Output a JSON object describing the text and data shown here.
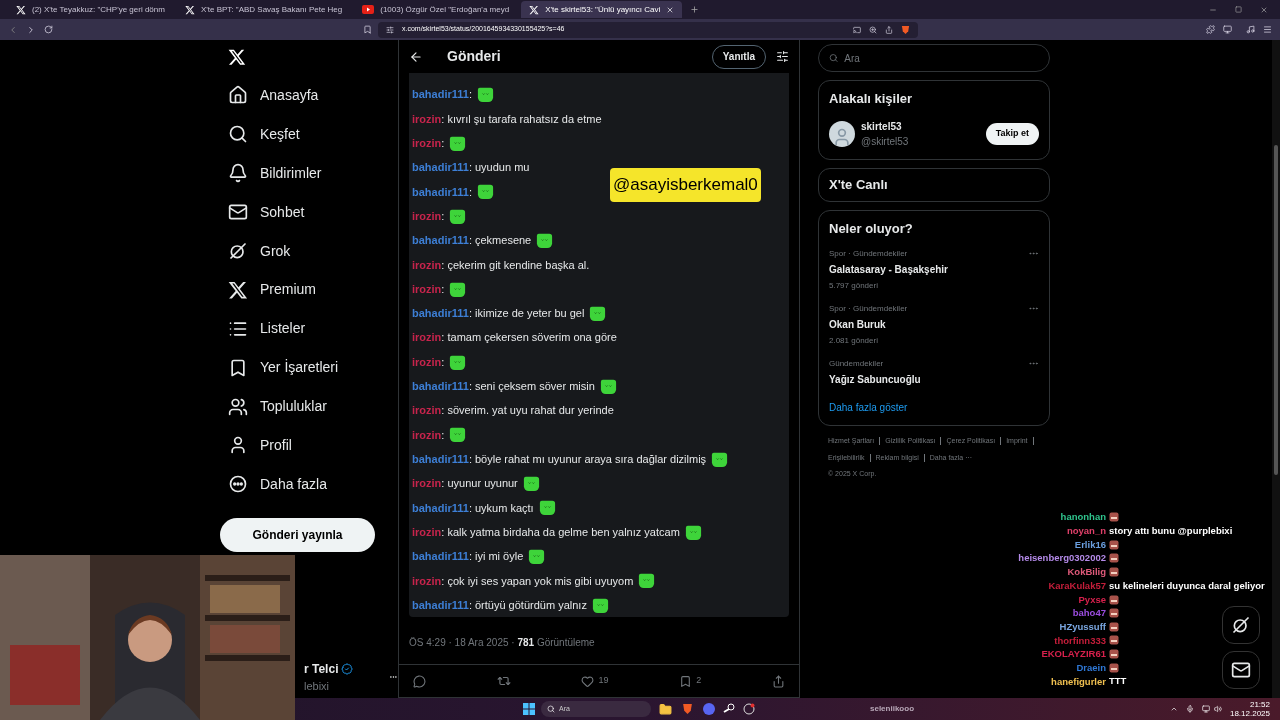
{
  "browser": {
    "tabs": [
      {
        "title": "(2) X'te Teyakkuz: \"CHP'ye geri dönm",
        "kind": "x",
        "selected": false
      },
      {
        "title": "X'te BPT: \"ABD Savaş Bakanı Pete Heg",
        "kind": "x",
        "selected": false
      },
      {
        "title": "(1003) Özgür Özel \"Erdoğan'a meyd",
        "kind": "video",
        "selected": false
      },
      {
        "title": "X'te skirtel53: \"Ünlü yayıncı Cavi",
        "kind": "x",
        "selected": true
      }
    ],
    "url": "x.com/skirtel53/status/2001645934330155425?s=46"
  },
  "nav": [
    {
      "label": "Anasayfa"
    },
    {
      "label": "Keşfet"
    },
    {
      "label": "Bildirimler"
    },
    {
      "label": "Sohbet"
    },
    {
      "label": "Grok"
    },
    {
      "label": "Premium"
    },
    {
      "label": "Listeler"
    },
    {
      "label": "Yer İşaretleri"
    },
    {
      "label": "Topluluklar"
    },
    {
      "label": "Profil"
    },
    {
      "label": "Daha fazla"
    }
  ],
  "post_button": "Gönderi yayınla",
  "account": {
    "name": "r Telci",
    "handle": "lebixi"
  },
  "post": {
    "title": "Gönderi",
    "reply_button": "Yanıtla",
    "tag": "@asayisberkemal0",
    "messages": [
      {
        "user": "bahadir111",
        "color": "#3d7fd6",
        "text": ":",
        "emote": true
      },
      {
        "user": "irozin",
        "color": "#c7244c",
        "text": ": kıvrıl şu tarafa rahatsız da etme",
        "emote": false
      },
      {
        "user": "irozin",
        "color": "#c7244c",
        "text": ":",
        "emote": true
      },
      {
        "user": "bahadir111",
        "color": "#3d7fd6",
        "text": ": uyudun mu",
        "emote": false
      },
      {
        "user": "bahadir111",
        "color": "#3d7fd6",
        "text": ":",
        "emote": true
      },
      {
        "user": "irozin",
        "color": "#c7244c",
        "text": ":",
        "emote": true
      },
      {
        "user": "bahadir111",
        "color": "#3d7fd6",
        "text": ": çekmesene",
        "emote": true
      },
      {
        "user": "irozin",
        "color": "#c7244c",
        "text": ": çekerim git kendine başka al.",
        "emote": false
      },
      {
        "user": "irozin",
        "color": "#c7244c",
        "text": ":",
        "emote": true
      },
      {
        "user": "bahadir111",
        "color": "#3d7fd6",
        "text": ": ikimize de yeter bu gel",
        "emote": true
      },
      {
        "user": "irozin",
        "color": "#c7244c",
        "text": ": tamam çekersen söverim ona göre",
        "emote": false
      },
      {
        "user": "irozin",
        "color": "#c7244c",
        "text": ":",
        "emote": true
      },
      {
        "user": "bahadir111",
        "color": "#3d7fd6",
        "text": ": seni çeksem söver misin",
        "emote": true
      },
      {
        "user": "irozin",
        "color": "#c7244c",
        "text": ": söverim. yat uyu rahat dur yerinde",
        "emote": false
      },
      {
        "user": "irozin",
        "color": "#c7244c",
        "text": ":",
        "emote": true
      },
      {
        "user": "bahadir111",
        "color": "#3d7fd6",
        "text": ": böyle rahat mı uyunur araya sıra dağlar dizilmiş",
        "emote": true
      },
      {
        "user": "irozin",
        "color": "#c7244c",
        "text": ": uyunur uyunur",
        "emote": true
      },
      {
        "user": "bahadir111",
        "color": "#3d7fd6",
        "text": ": uykum kaçtı",
        "emote": true
      },
      {
        "user": "irozin",
        "color": "#c7244c",
        "text": ": kalk yatma birdaha da gelme ben yalnız yatcam",
        "emote": true
      },
      {
        "user": "bahadir111",
        "color": "#3d7fd6",
        "text": ": iyi mi öyle",
        "emote": true
      },
      {
        "user": "irozin",
        "color": "#c7244c",
        "text": ": çok iyi ses yapan yok mis gibi uyuyom",
        "emote": true
      },
      {
        "user": "bahadir111",
        "color": "#3d7fd6",
        "text": ": örtüyü götürdüm yalnız",
        "emote": true
      }
    ],
    "time": "ÖS 4:29 · 18 Ara 2025 · ",
    "views": "781",
    "views_label": "Görüntüleme",
    "likes": "19",
    "bookmarks": "2"
  },
  "sidebar": {
    "search": {
      "placeholder": "Ara"
    },
    "people_title": "Alakalı kişiler",
    "person": {
      "name": "skirtel53",
      "handle": "@skirtel53",
      "button": "Takip et"
    },
    "live_title": "X'te Canlı",
    "trends_title": "Neler oluyor?",
    "trends": [
      {
        "meta": "Spor · Gündemdekiler",
        "title": "Galatasaray - Başakşehir",
        "count": "5.797 gönderi"
      },
      {
        "meta": "Spor · Gündemdekiler",
        "title": "Okan Buruk",
        "count": "2.081 gönderi"
      },
      {
        "meta": "Gündemdekiler",
        "title": "Yağız Sabuncuoğlu"
      }
    ],
    "show_more": "Daha fazla göster",
    "footer": [
      "Hizmet Şartları",
      "Gizlilik Politikası",
      "Çerez Politikası",
      "Imprint",
      "Erişilebilirlik",
      "Reklam bilgisi",
      "Daha fazla ···"
    ],
    "copyright": "© 2025 X Corp."
  },
  "stream_chat": [
    {
      "user": "hanonhan",
      "color": "#2fc48d"
    },
    {
      "user": "noyan_n",
      "color": "#e0406a",
      "text": "story attı bunu @purplebixi"
    },
    {
      "user": "Erlik16",
      "color": "#6a9fe0"
    },
    {
      "user": "heisenberg0302002",
      "color": "#b48ae8"
    },
    {
      "user": "KokBilig",
      "color": "#e05a7a"
    },
    {
      "user": "KaraKulak57",
      "color": "#c41e3a",
      "text": "su kelineleri duyunca daral geliyor"
    },
    {
      "user": "Pyxse",
      "color": "#d6204c"
    },
    {
      "user": "baho47",
      "color": "#9b4de0"
    },
    {
      "user": "HZyussuff",
      "color": "#7aa6e0"
    },
    {
      "user": "thorfinn333",
      "color": "#c41e3a"
    },
    {
      "user": "EKOLAYZIR61",
      "color": "#d6204c"
    },
    {
      "user": "Draein",
      "color": "#2f78d6"
    },
    {
      "user": "hanefigurler",
      "color": "#f0c050",
      "text": "TTT"
    }
  ],
  "taskbar": {
    "search": {
      "placeholder": "Ara"
    },
    "streamer": "seleniikooo",
    "time": "21:52",
    "date": "18.12.2025"
  }
}
